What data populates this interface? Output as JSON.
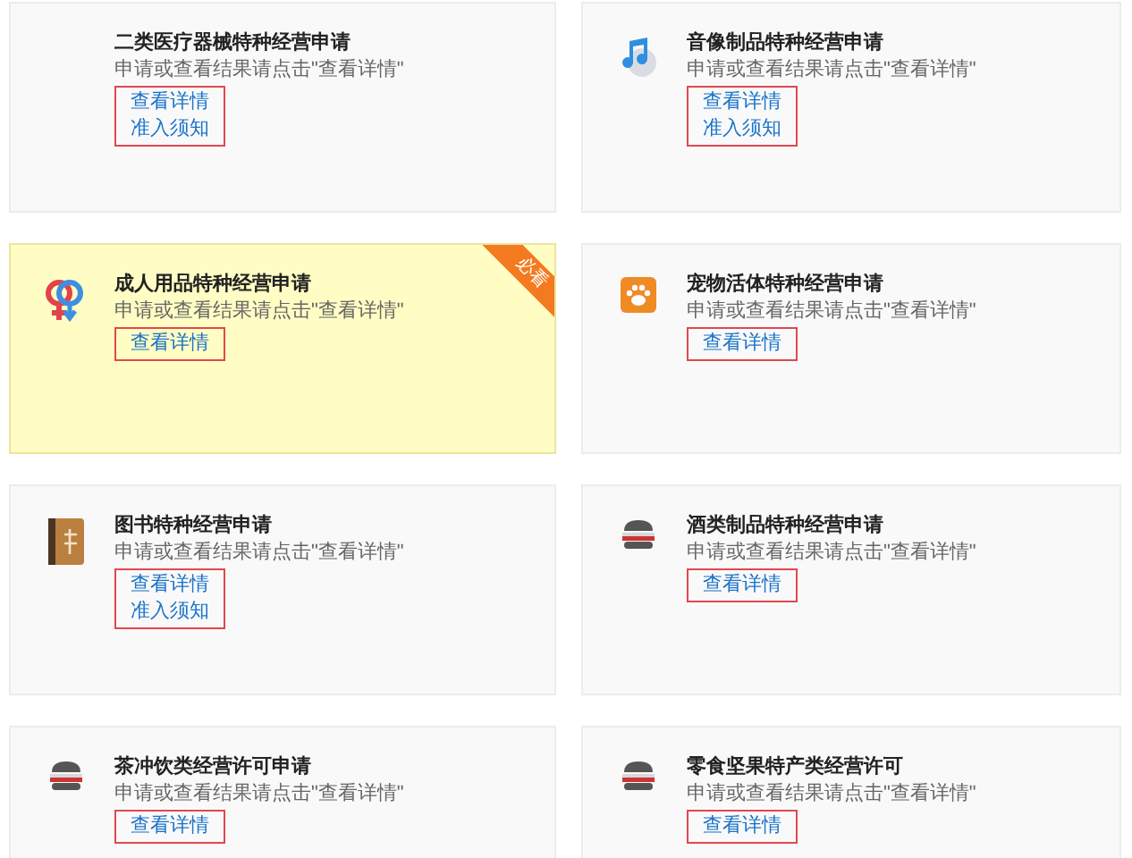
{
  "cards": [
    {
      "kind": "plain",
      "title": "二类医疗器械特种经营申请",
      "subtitle": "申请或查看结果请点击\"查看详情\"",
      "highlighted": false,
      "links": [
        "查看详情",
        "准入须知"
      ]
    },
    {
      "kind": "music",
      "title": "音像制品特种经营申请",
      "subtitle": "申请或查看结果请点击\"查看详情\"",
      "highlighted": false,
      "links": [
        "查看详情",
        "准入须知"
      ]
    },
    {
      "kind": "gender",
      "title": "成人用品特种经营申请",
      "subtitle": "申请或查看结果请点击\"查看详情\"",
      "highlighted": true,
      "ribbon": "必看",
      "links": [
        "查看详情"
      ]
    },
    {
      "kind": "paw",
      "title": "宠物活体特种经营申请",
      "subtitle": "申请或查看结果请点击\"查看详情\"",
      "highlighted": false,
      "links": [
        "查看详情"
      ]
    },
    {
      "kind": "book",
      "title": "图书特种经营申请",
      "subtitle": "申请或查看结果请点击\"查看详情\"",
      "highlighted": false,
      "links": [
        "查看详情",
        "准入须知"
      ]
    },
    {
      "kind": "burger",
      "title": "酒类制品特种经营申请",
      "subtitle": "申请或查看结果请点击\"查看详情\"",
      "highlighted": false,
      "links": [
        "查看详情"
      ]
    },
    {
      "kind": "burger",
      "title": "茶冲饮类经营许可申请",
      "subtitle": "申请或查看结果请点击\"查看详情\"",
      "highlighted": false,
      "links": [
        "查看详情"
      ]
    },
    {
      "kind": "burger",
      "title": "零食坚果特产类经营许可",
      "subtitle": "申请或查看结果请点击\"查看详情\"",
      "highlighted": false,
      "links": [
        "查看详情"
      ]
    }
  ]
}
